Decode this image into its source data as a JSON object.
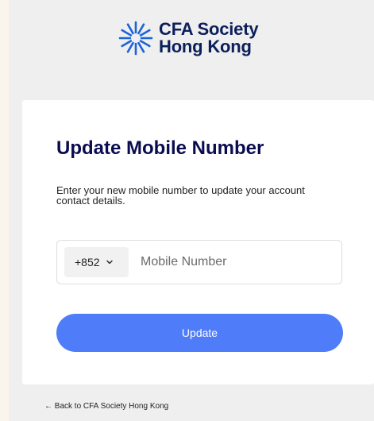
{
  "brand": {
    "line1": "CFA Society",
    "line2": "Hong Kong",
    "color": "#0b1f5b",
    "mark_color": "#1d63d8"
  },
  "card": {
    "title": "Update Mobile Number",
    "description": "Enter your new mobile number to update your account contact details."
  },
  "phone": {
    "country_code": "+852",
    "placeholder": "Mobile Number",
    "value": ""
  },
  "actions": {
    "update_label": "Update",
    "back_label": "← Back to CFA Society Hong Kong"
  },
  "colors": {
    "accent": "#4f7cf9",
    "title": "#0b0c4f"
  }
}
